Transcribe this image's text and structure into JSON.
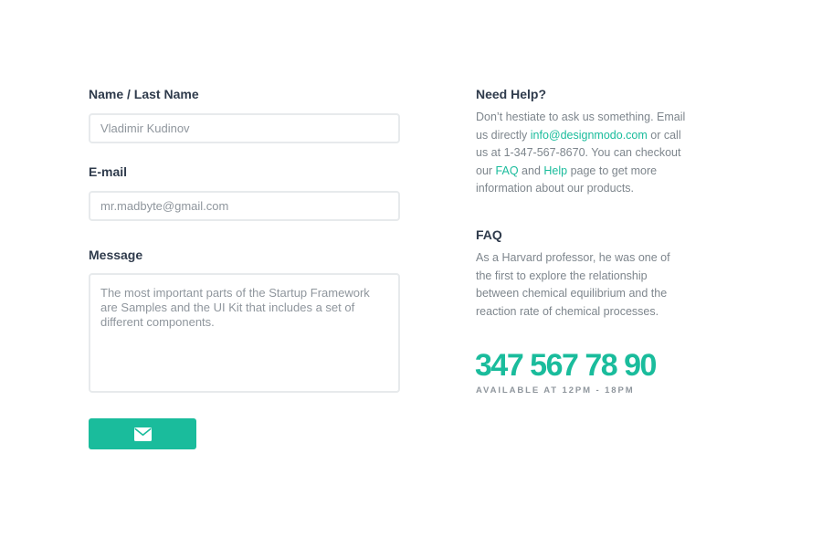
{
  "form": {
    "name_label": "Name / Last Name",
    "name_placeholder": "Vladimir Kudinov",
    "email_label": "E-mail",
    "email_placeholder": "mr.madbyte@gmail.com",
    "message_label": "Message",
    "message_placeholder": "The most important parts of the Startup Framework are Samples and the UI Kit that includes a set of different components.",
    "send_icon": "envelope-icon"
  },
  "help": {
    "heading": "Need Help?",
    "text_1": "Don’t hestiate to ask us something. Email us directly ",
    "email_link": "info@designmodo.com",
    "text_2": " or call us at 1-347-567-8670. You can checkout our ",
    "faq_link": "FAQ",
    "text_3": " and ",
    "help_link": "Help",
    "text_4": " page to get more information about our products."
  },
  "faq": {
    "heading": "FAQ",
    "text": "As a Harvard professor, he was one of the first to explore the relationship between chemical equilibrium and the reaction rate of chemical processes."
  },
  "contact": {
    "phone": "347 567 78 90",
    "availability": "AVAILABLE AT 12PM - 18PM"
  },
  "colors": {
    "accent": "#1abc9c",
    "heading": "#2f3b4c",
    "body_text": "#7e868d",
    "input_border": "#e7eaec"
  }
}
